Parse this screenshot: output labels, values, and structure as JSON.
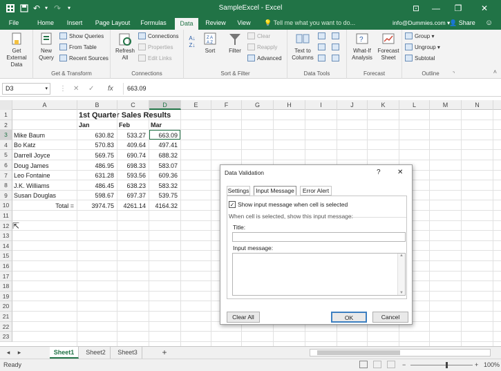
{
  "titlebar": {
    "app_title": "SampleExcel - Excel",
    "minimize": "—",
    "restore": "❐",
    "close": "✕",
    "ribbon_display": "⊡",
    "accent": "#217346"
  },
  "tabs": {
    "file": "File",
    "home": "Home",
    "insert": "Insert",
    "page_layout": "Page Layout",
    "formulas": "Formulas",
    "data": "Data",
    "review": "Review",
    "view": "View",
    "tell_me": "Tell me what you want to do...",
    "account": "info@Dummies.com",
    "share": "Share"
  },
  "ribbon": {
    "get_external": "Get External Data",
    "new_query": "New Query",
    "show_queries": "Show Queries",
    "from_table": "From Table",
    "recent_sources": "Recent Sources",
    "get_transform": "Get & Transform",
    "refresh_all": "Refresh All",
    "connections": "Connections",
    "properties": "Properties",
    "edit_links": "Edit Links",
    "connections_label": "Connections",
    "sort": "Sort",
    "filter": "Filter",
    "clear": "Clear",
    "reapply": "Reapply",
    "advanced": "Advanced",
    "sort_filter": "Sort & Filter",
    "text_to_columns": "Text to Columns",
    "data_tools": "Data Tools",
    "what_if": "What-If Analysis",
    "forecast_sheet": "Forecast Sheet",
    "forecast": "Forecast",
    "group": "Group",
    "ungroup": "Ungroup",
    "subtotal": "Subtotal",
    "outline": "Outline"
  },
  "formula_bar": {
    "name_box": "D3",
    "cancel": "✕",
    "enter": "✓",
    "fx": "fx",
    "value": "663.09"
  },
  "sheet": {
    "columns": [
      "A",
      "B",
      "C",
      "D",
      "E",
      "F",
      "G",
      "H",
      "I",
      "J",
      "K",
      "L",
      "M",
      "N"
    ],
    "rows": [
      "1",
      "2",
      "3",
      "4",
      "5",
      "6",
      "7",
      "8",
      "9",
      "10",
      "11",
      "12",
      "13",
      "14",
      "15",
      "16",
      "17",
      "18",
      "19",
      "20",
      "21",
      "22",
      "23"
    ],
    "title": "1st Quarter Sales Results",
    "headers": {
      "jan": "Jan",
      "feb": "Feb",
      "mar": "Mar"
    },
    "data": [
      {
        "name": "Mike Baum",
        "jan": "630.82",
        "feb": "533.27",
        "mar": "663.09"
      },
      {
        "name": "Bo Katz",
        "jan": "570.83",
        "feb": "409.64",
        "mar": "497.41"
      },
      {
        "name": "Darrell Joyce",
        "jan": "569.75",
        "feb": "690.74",
        "mar": "688.32"
      },
      {
        "name": "Doug James",
        "jan": "486.95",
        "feb": "698.33",
        "mar": "583.07"
      },
      {
        "name": "Leo Fontaine",
        "jan": "631.28",
        "feb": "593.56",
        "mar": "609.36"
      },
      {
        "name": "J.K. Williams",
        "jan": "486.45",
        "feb": "638.23",
        "mar": "583.32"
      },
      {
        "name": "Susan Douglas",
        "jan": "598.67",
        "feb": "697.37",
        "mar": "539.75"
      }
    ],
    "total": {
      "label": "Total =",
      "jan": "3974.75",
      "feb": "4261.14",
      "mar": "4164.32"
    }
  },
  "sheet_tabs": {
    "sheet1": "Sheet1",
    "sheet2": "Sheet2",
    "sheet3": "Sheet3",
    "add": "+"
  },
  "status": {
    "ready": "Ready",
    "zoom": "100%",
    "minus": "−",
    "plus": "+"
  },
  "dialog": {
    "title": "Data Validation",
    "help": "?",
    "close": "✕",
    "tab_settings": "Settings",
    "tab_input": "Input Message",
    "tab_error": "Error Alert",
    "show_checkbox_label": "Show input message when cell is selected",
    "show_checked": true,
    "when_selected": "When cell is selected, show this input message:",
    "title_label": "Title:",
    "title_value": "",
    "input_label": "Input message:",
    "input_value": "",
    "clear_all": "Clear All",
    "ok": "OK",
    "cancel": "Cancel"
  }
}
